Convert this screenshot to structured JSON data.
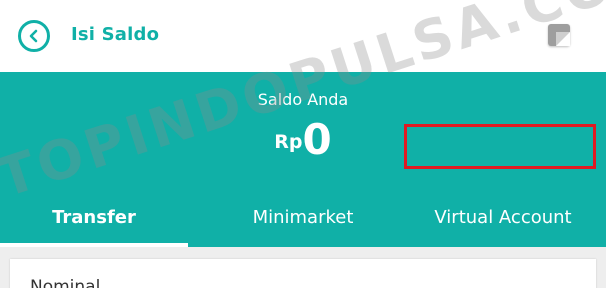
{
  "header": {
    "title": "Isi Saldo",
    "back_icon": "back-arrow-icon",
    "note_icon": "note-icon"
  },
  "balance": {
    "label": "Saldo Anda",
    "currency": "Rp",
    "amount": "0"
  },
  "tabs": [
    {
      "label": "Transfer",
      "active": true
    },
    {
      "label": "Minimarket",
      "active": false
    },
    {
      "label": "Virtual Account",
      "active": false,
      "highlighted": true
    }
  ],
  "form": {
    "nominal_label": "Nominal"
  },
  "watermark": "TOPINDOPULSA.COM",
  "colors": {
    "primary": "#10b0a7",
    "highlight": "#e01a22",
    "background": "#eeeeee"
  }
}
